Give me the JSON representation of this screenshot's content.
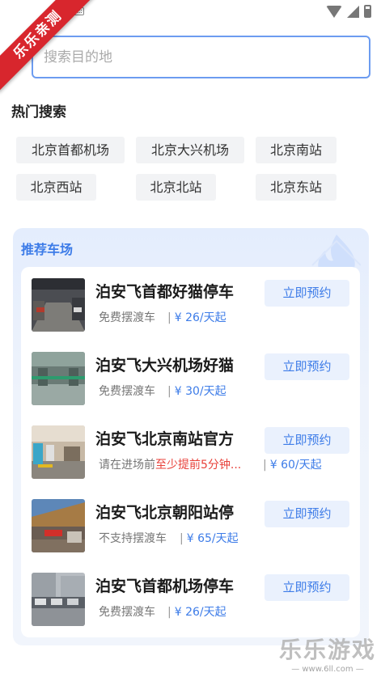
{
  "watermark": {
    "ribbon": "乐乐亲测",
    "brand": "乐乐游戏",
    "url": "— www.6ll.com —"
  },
  "search": {
    "placeholder": "搜索目的地",
    "value": ""
  },
  "hot": {
    "title": "热门搜索",
    "chips": [
      "北京首都机场",
      "北京大兴机场",
      "北京南站",
      "北京西站",
      "北京北站",
      "北京东站"
    ]
  },
  "recommend": {
    "title": "推荐车场",
    "lots": [
      {
        "name": "泊安飞首都好猫停车",
        "tag": "免费摆渡车",
        "warn": "",
        "price": "¥ 26/天起",
        "button": "立即预约"
      },
      {
        "name": "泊安飞大兴机场好猫",
        "tag": "免费摆渡车",
        "warn": "",
        "price": "¥ 30/天起",
        "button": "立即预约"
      },
      {
        "name": "泊安飞北京南站官方",
        "tag": "请在进场前",
        "warn": "至少提前5分钟...",
        "price": "¥ 60/天起",
        "button": "立即预约"
      },
      {
        "name": "泊安飞北京朝阳站停",
        "tag": "不支持摆渡车",
        "warn": "",
        "price": "¥ 65/天起",
        "button": "立即预约"
      },
      {
        "name": "泊安飞首都机场停车",
        "tag": "免费摆渡车",
        "warn": "",
        "price": "¥ 26/天起",
        "button": "立即预约"
      }
    ]
  },
  "colors": {
    "accent": "#3d7ce8",
    "warn": "#e8413a",
    "ribbon": "#d8262d"
  }
}
